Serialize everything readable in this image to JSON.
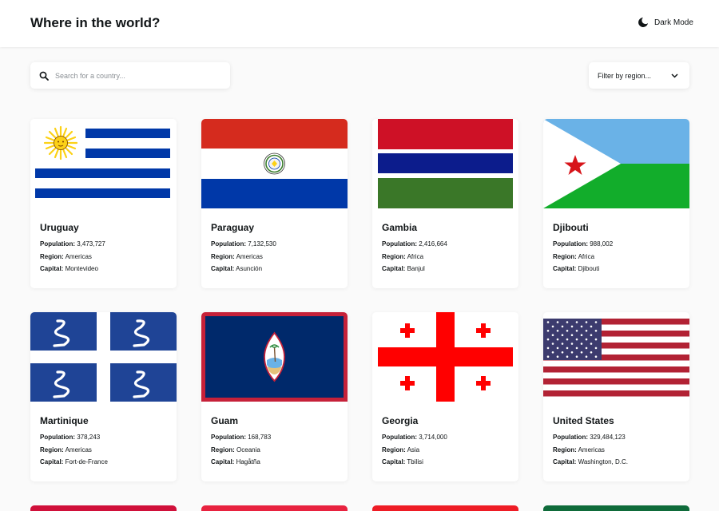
{
  "header": {
    "title": "Where in the world?",
    "mode_label": "Dark Mode"
  },
  "search": {
    "placeholder": "Search for a country..."
  },
  "filter": {
    "label": "Filter by region..."
  },
  "stat_labels": {
    "population": "Population:",
    "region": "Region:",
    "capital": "Capital:"
  },
  "countries": [
    {
      "name": "Uruguay",
      "population": "3,473,727",
      "region": "Americas",
      "capital": "Montevideo"
    },
    {
      "name": "Paraguay",
      "population": "7,132,530",
      "region": "Americas",
      "capital": "Asunción"
    },
    {
      "name": "Gambia",
      "population": "2,416,664",
      "region": "Africa",
      "capital": "Banjul"
    },
    {
      "name": "Djibouti",
      "population": "988,002",
      "region": "Africa",
      "capital": "Djibouti"
    },
    {
      "name": "Martinique",
      "population": "378,243",
      "region": "Americas",
      "capital": "Fort-de-France"
    },
    {
      "name": "Guam",
      "population": "168,783",
      "region": "Oceania",
      "capital": "Hagåtña"
    },
    {
      "name": "Georgia",
      "population": "3,714,000",
      "region": "Asia",
      "capital": "Tbilisi"
    },
    {
      "name": "United States",
      "population": "329,484,123",
      "region": "Americas",
      "capital": "Washington, D.C."
    }
  ],
  "colors": {
    "background": "#fafafa",
    "card": "#ffffff",
    "text": "#111517"
  }
}
